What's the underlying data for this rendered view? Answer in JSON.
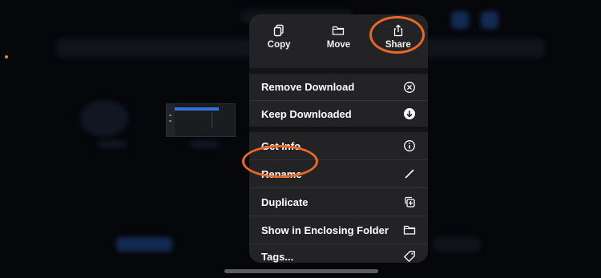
{
  "menu": {
    "actions": [
      {
        "label": "Copy",
        "icon": "doc-on-doc-icon"
      },
      {
        "label": "Move",
        "icon": "folder-icon"
      },
      {
        "label": "Share",
        "icon": "square-arrow-up-icon"
      }
    ],
    "group1": [
      {
        "label": "Remove Download",
        "icon": "x-circle-icon"
      },
      {
        "label": "Keep Downloaded",
        "icon": "arrow-down-circle-fill-icon"
      }
    ],
    "group2": [
      {
        "label": "Get Info",
        "icon": "info-circle-icon"
      },
      {
        "label": "Rename",
        "icon": "pencil-icon"
      },
      {
        "label": "Duplicate",
        "icon": "plus-square-on-square-icon"
      },
      {
        "label": "Show in Enclosing Folder",
        "icon": "folder-icon"
      },
      {
        "label": "Tags...",
        "icon": "tag-icon"
      }
    ]
  },
  "colors": {
    "menu_background": "#232325",
    "highlight_ring": "#e8682a",
    "background": "#06070b"
  }
}
